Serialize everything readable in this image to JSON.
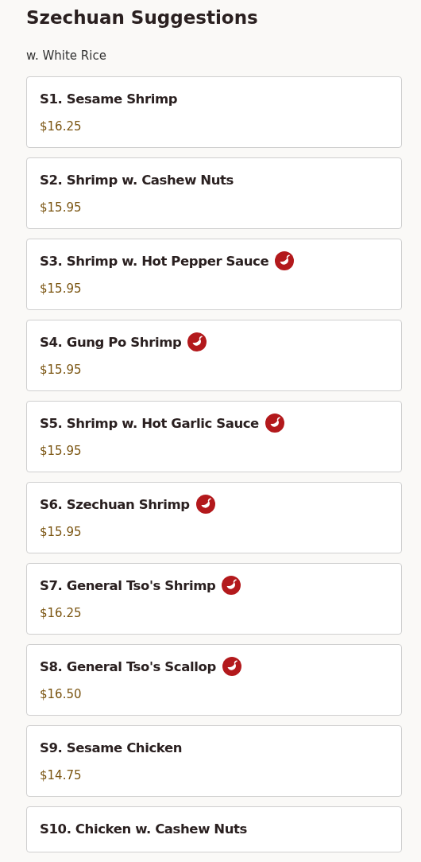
{
  "section": {
    "title": "Szechuan Suggestions",
    "note": "w. White Rice"
  },
  "items": [
    {
      "name": "S1. Sesame Shrimp",
      "price": "$16.25",
      "spicy": false
    },
    {
      "name": "S2. Shrimp w. Cashew Nuts",
      "price": "$15.95",
      "spicy": false
    },
    {
      "name": "S3. Shrimp w. Hot Pepper Sauce",
      "price": "$15.95",
      "spicy": true
    },
    {
      "name": "S4. Gung Po Shrimp",
      "price": "$15.95",
      "spicy": true
    },
    {
      "name": "S5. Shrimp w. Hot Garlic Sauce",
      "price": "$15.95",
      "spicy": true
    },
    {
      "name": "S6. Szechuan Shrimp",
      "price": "$15.95",
      "spicy": true
    },
    {
      "name": "S7. General Tso's Shrimp",
      "price": "$16.25",
      "spicy": true
    },
    {
      "name": "S8. General Tso's Scallop",
      "price": "$16.50",
      "spicy": true
    },
    {
      "name": "S9. Sesame Chicken",
      "price": "$14.75",
      "spicy": false
    },
    {
      "name": "S10. Chicken w. Cashew Nuts",
      "spicy": false
    }
  ]
}
